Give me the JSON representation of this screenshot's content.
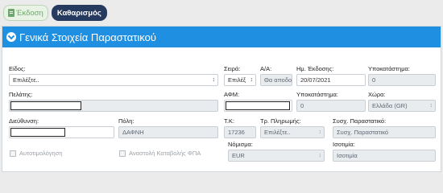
{
  "toolbar": {
    "issue_label": "Έκδοση",
    "clear_label": "Καθαρισμός"
  },
  "panel": {
    "title": "Γενικά Στοιχεία Παραστατικού"
  },
  "form": {
    "type": {
      "label": "Είδος:",
      "value": "Επιλέξτε.."
    },
    "series": {
      "label": "Σειρά:",
      "value": "Επιλέξ"
    },
    "aa": {
      "label": "Α/Α:",
      "value": "Θα αποδο"
    },
    "issue_date": {
      "label": "Ημ. Έκδοσης:",
      "value": "20/07/2021"
    },
    "branch": {
      "label": "Υποκατάστημα:",
      "value": "0"
    },
    "customer": {
      "label": "Πελάτης:",
      "value": ""
    },
    "afm": {
      "label": "ΑΦΜ:",
      "value": ""
    },
    "customer_branch": {
      "label": "Υποκατάστημα:",
      "value": "0"
    },
    "country": {
      "label": "Χώρα:",
      "value": "Ελλάδα (GR)"
    },
    "address": {
      "label": "Διεύθυνση:",
      "value": ""
    },
    "city": {
      "label": "Πόλη:",
      "value": "ΔΑΦΝΗ"
    },
    "postal": {
      "label": "Τ.Κ:",
      "value": "17236"
    },
    "payment": {
      "label": "Τρ. Πληρωμής:",
      "value": "Επιλέξτε.."
    },
    "related_doc": {
      "label": "Συσχ. Παραστατικό:",
      "value": "Συσχ. Παραστατικό"
    },
    "currency": {
      "label": "Νόμισμα:",
      "value": "EUR"
    },
    "rate": {
      "label": "Ισοτιμία:",
      "value": "Ισοτιμία"
    },
    "self_billing": {
      "label": "Αυτοτιμολόγηση"
    },
    "vat_suspension": {
      "label": "Αναστολή Καταβολής ΦΠΑ"
    }
  }
}
